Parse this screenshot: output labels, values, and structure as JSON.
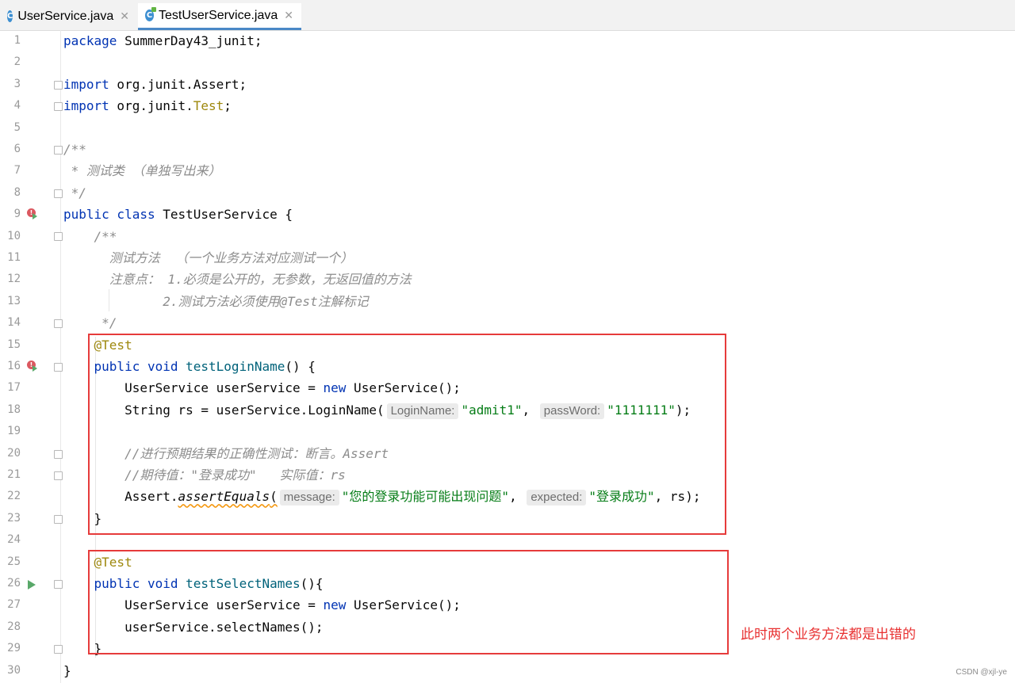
{
  "tabs": [
    {
      "label": "UserService.java",
      "icon": "class-icon",
      "active": false
    },
    {
      "label": "TestUserService.java",
      "icon": "test-class-icon",
      "active": true
    }
  ],
  "lines": {
    "l1_kw": "package",
    "l1_rest": " SummerDay43_junit;",
    "l3_kw": "import",
    "l3_rest": " org.junit.Assert;",
    "l4_kw": "import",
    "l4_rest": " org.junit.",
    "l4_ann": "Test",
    "l4_end": ";",
    "l6": "/**",
    "l7": " * 测试类 （单独写出来）",
    "l8": " */",
    "l9_kw": "public class",
    "l9_rest": " TestUserService {",
    "l10": "    /**",
    "l11": "      测试方法  （一个业务方法对应测试一个）",
    "l12": "      注意点： 1.必须是公开的，无参数，无返回值的方法",
    "l13": "             2.测试方法必须使用@Test注解标记",
    "l14": "     */",
    "l15_ann": "    @Test",
    "l16_kw": "    public void",
    "l16_fn": " testLoginName",
    "l16_rest": "() {",
    "l17_a": "        UserService userService = ",
    "l17_kw": "new",
    "l17_b": " UserService();",
    "l18_a": "        String rs = userService.LoginName(",
    "l18_h1": "LoginName:",
    "l18_s1": "\"admit1\"",
    "l18_c": ", ",
    "l18_h2": "passWord:",
    "l18_s2": "\"1111111\"",
    "l18_end": ");",
    "l20": "        //进行预期结果的正确性测试：断言。Assert",
    "l21": "        //期待值：\"登录成功\"   实际值：rs",
    "l22_a": "        Assert.",
    "l22_m": "assertEquals",
    "l22_p": "(",
    "l22_h1": "message:",
    "l22_s1": "\"您的登录功能可能出现问题\"",
    "l22_c": ", ",
    "l22_h2": "expected:",
    "l22_s2": "\"登录成功\"",
    "l22_end": ", rs);",
    "l23": "    }",
    "l25_ann": "    @Test",
    "l26_kw": "    public void",
    "l26_fn": " testSelectNames",
    "l26_rest": "(){",
    "l27_a": "        UserService userService = ",
    "l27_kw": "new",
    "l27_b": " UserService();",
    "l28": "        userService.selectNames();",
    "l29": "    }",
    "l30": "}"
  },
  "line_numbers": [
    "1",
    "2",
    "3",
    "4",
    "5",
    "6",
    "7",
    "8",
    "9",
    "10",
    "11",
    "12",
    "13",
    "14",
    "15",
    "16",
    "17",
    "18",
    "19",
    "20",
    "21",
    "22",
    "23",
    "24",
    "25",
    "26",
    "27",
    "28",
    "29",
    "30"
  ],
  "annotation_note": "此时两个业务方法都是出错的",
  "watermark": "CSDN @xjl-ye",
  "colors": {
    "keyword": "#0033b3",
    "annotation": "#9e880d",
    "string": "#067d17",
    "comment": "#8c8c8c",
    "highlight_box": "#e63b3b"
  }
}
